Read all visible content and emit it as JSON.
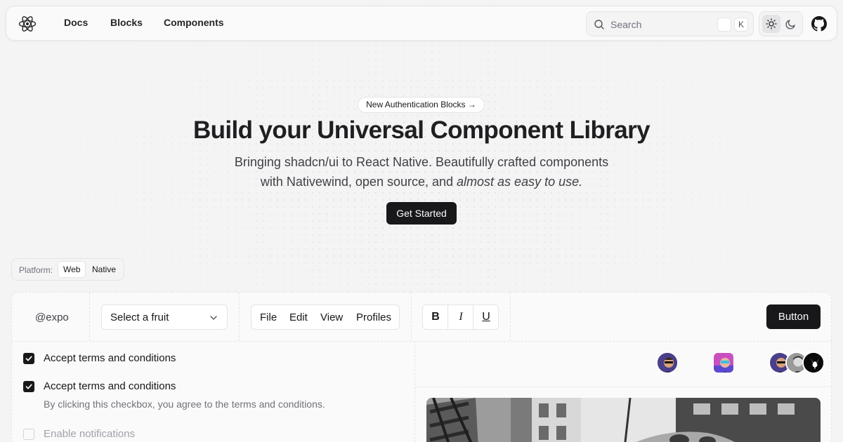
{
  "nav": {
    "logo_icon": "react-atom-icon",
    "links": [
      "Docs",
      "Blocks",
      "Components"
    ],
    "search": {
      "placeholder": "Search",
      "shortcut": "K"
    },
    "theme": {
      "light_icon": "sun-icon",
      "dark_icon": "moon-icon",
      "active": "light"
    },
    "github_icon": "github-icon"
  },
  "hero": {
    "badge": "New Authentication Blocks →",
    "title": "Build your Universal Component Library",
    "subtitle_line1": "Bringing shadcn/ui to React Native. Beautifully crafted components",
    "subtitle_line2_plain": "with Nativewind, open source, and ",
    "subtitle_line2_emph": "almost as easy to use.",
    "cta": "Get Started"
  },
  "platform": {
    "label": "Platform:",
    "options": [
      "Web",
      "Native"
    ],
    "selected": "Web"
  },
  "showcase": {
    "handle": "@expo",
    "select_placeholder": "Select a fruit",
    "menubar": [
      "File",
      "Edit",
      "View",
      "Profiles"
    ],
    "formatting": {
      "bold": "B",
      "italic": "I",
      "underline": "U"
    },
    "button": "Button",
    "checkboxes": [
      {
        "label": "Accept terms and conditions",
        "checked": true
      },
      {
        "label": "Accept terms and conditions",
        "checked": true,
        "description": "By clicking this checkbox, you agree to the terms and conditions."
      },
      {
        "label": "Enable notifications",
        "checked": false,
        "disabled": true
      }
    ]
  },
  "colors": {
    "primary": "#18181b",
    "background": "#f4f4f4",
    "border": "#e4e4e7",
    "muted_text": "#71717a"
  }
}
